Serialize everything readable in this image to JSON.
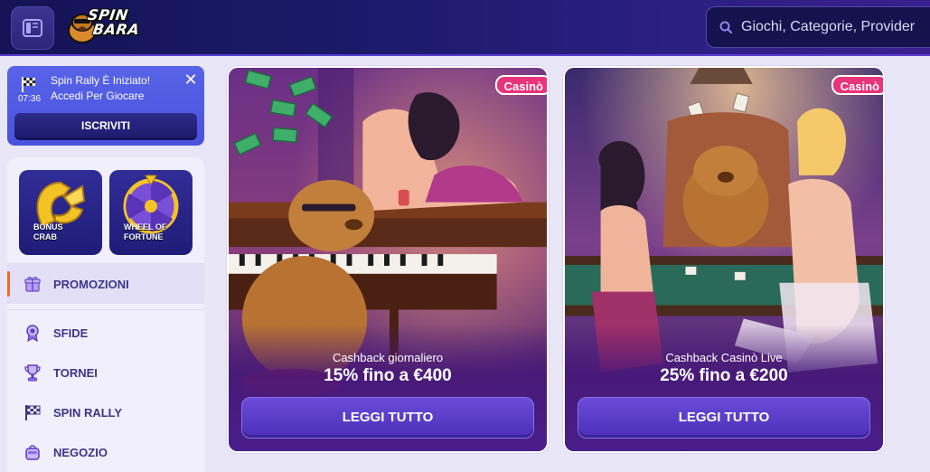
{
  "header": {
    "logo_line1": "SPIN",
    "logo_line2": "BARA",
    "search_placeholder": "Giochi, Categorie, Provider",
    "bg_color": "#1b1a6b"
  },
  "notice": {
    "time": "07:36",
    "line1": "Spin Rally È Iniziato!",
    "line2": "Accedi Per Giocare",
    "button": "ISCRIVITI",
    "close_icon": "close-icon"
  },
  "tiles": [
    {
      "label_line1": "BONUS",
      "label_line2": "CRAB",
      "icon": "crab-claw-icon"
    },
    {
      "label_line1": "WHEEL OF",
      "label_line2": "FORTUNE",
      "icon": "fortune-wheel-icon"
    }
  ],
  "nav": [
    {
      "label": "PROMOZIONI",
      "icon": "gift-icon",
      "active": true
    },
    {
      "label": "SFIDE",
      "icon": "medal-icon",
      "active": false
    },
    {
      "label": "TORNEI",
      "icon": "trophy-icon",
      "active": false
    },
    {
      "label": "SPIN RALLY",
      "icon": "checkered-flag-icon",
      "active": false
    },
    {
      "label": "NEGOZIO",
      "icon": "bag-icon",
      "active": false
    }
  ],
  "promos": [
    {
      "badge": "Casinò",
      "subtitle": "Cashback giornaliero",
      "title": "15% fino a €400",
      "button": "LEGGI TUTTO"
    },
    {
      "badge": "Casinò",
      "subtitle": "Cashback Casinò Live",
      "title": "25% fino a €200",
      "button": "LEGGI TUTTO"
    }
  ],
  "colors": {
    "accent": "#f26a21",
    "badge": "#e8347a",
    "button": "#5a3dcc"
  }
}
